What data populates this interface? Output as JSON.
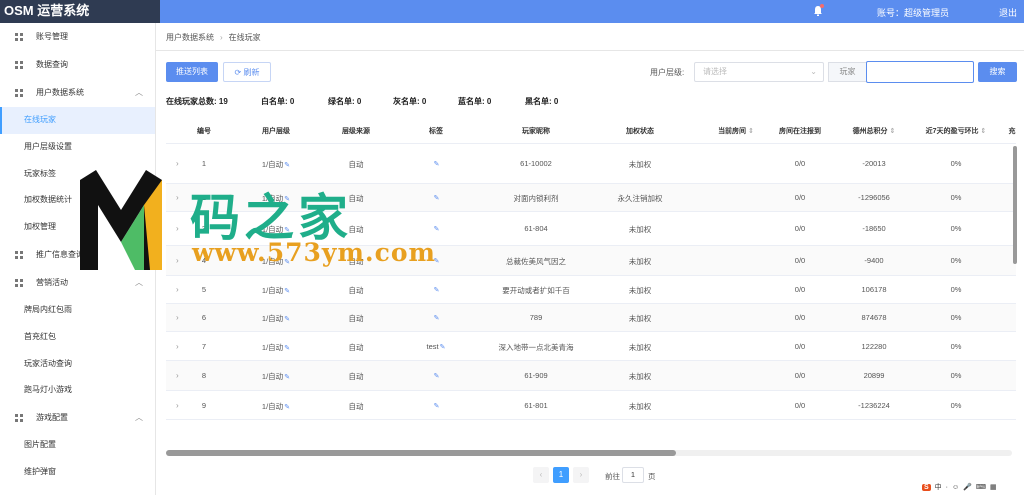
{
  "app": {
    "title": "OSM 运营系统"
  },
  "header": {
    "account_label": "账号：超级管理员",
    "logout_label": "退出"
  },
  "sidebar": {
    "groups": [
      {
        "label": "账号管理",
        "expandable": false
      },
      {
        "label": "数据查询",
        "expandable": false
      },
      {
        "label": "用户数据系统",
        "expandable": true,
        "children": [
          "在线玩家",
          "用户层级设置",
          "玩家标签",
          "加权数据统计",
          "加权管理"
        ]
      },
      {
        "label": "推广信息查询",
        "expandable": false
      },
      {
        "label": "营销活动",
        "expandable": true,
        "children": [
          "牌局内红包雨",
          "首充红包",
          "玩家活动查询",
          "跑马灯小游戏"
        ]
      },
      {
        "label": "游戏配置",
        "expandable": true,
        "children": [
          "图片配置",
          "维护弹窗"
        ]
      }
    ],
    "active_item": "在线玩家"
  },
  "breadcrumb": [
    "用户数据系统",
    "在线玩家"
  ],
  "toolbar": {
    "push_list_label": "推送列表",
    "refresh_label": "刷新",
    "user_level_label": "用户层级:",
    "select_placeholder": "请选择",
    "search_prefix": "玩家",
    "search_value": "",
    "search_button_label": "搜索"
  },
  "stats": {
    "online_total": "在线玩家总数: 19",
    "whitelist": "白名单: 0",
    "greenlist": "绿名单: 0",
    "graylist": "灰名单: 0",
    "bluelist": "蓝名单: 0",
    "blacklist": "黑名单: 0"
  },
  "table": {
    "headers": [
      "编号",
      "用户层级",
      "层级来源",
      "标签",
      "玩家昵称",
      "加权状态",
      "当前房间",
      "房间在注报到",
      "德州总积分",
      "近7天的盈亏环比",
      "充"
    ],
    "sortable": [
      false,
      false,
      false,
      false,
      false,
      false,
      true,
      false,
      true,
      true,
      false
    ],
    "rows": [
      {
        "id": "1",
        "level": "1/自动",
        "source": "自动",
        "tag": "",
        "nickname": "61-10002",
        "status": "未加权",
        "room": "",
        "report": "0/0",
        "score": "-20013",
        "ratio": "0%"
      },
      {
        "id": "2",
        "level": "1/自动",
        "source": "自动",
        "tag": "",
        "nickname": "对面内锁利剂",
        "status": "永久注销加权",
        "room": "",
        "report": "0/0",
        "score": "-1296056",
        "ratio": "0%"
      },
      {
        "id": "3",
        "level": "1/自动",
        "source": "自动",
        "tag": "",
        "nickname": "61-804",
        "status": "未加权",
        "room": "",
        "report": "0/0",
        "score": "-18650",
        "ratio": "0%"
      },
      {
        "id": "4",
        "level": "1/自动",
        "source": "自动",
        "tag": "",
        "nickname": "总裁佐美风气因之",
        "status": "未加权",
        "room": "",
        "report": "0/0",
        "score": "-9400",
        "ratio": "0%"
      },
      {
        "id": "5",
        "level": "1/自动",
        "source": "自动",
        "tag": "",
        "nickname": "要开动或者扩如千百",
        "status": "未加权",
        "room": "",
        "report": "0/0",
        "score": "106178",
        "ratio": "0%"
      },
      {
        "id": "6",
        "level": "1/自动",
        "source": "自动",
        "tag": "",
        "nickname": "789",
        "status": "未加权",
        "room": "",
        "report": "0/0",
        "score": "874678",
        "ratio": "0%"
      },
      {
        "id": "7",
        "level": "1/自动",
        "source": "自动",
        "tag": "test",
        "nickname": "深入地带一点北美青海",
        "status": "未加权",
        "room": "",
        "report": "0/0",
        "score": "122280",
        "ratio": "0%"
      },
      {
        "id": "8",
        "level": "1/自动",
        "source": "自动",
        "tag": "",
        "nickname": "61-909",
        "status": "未加权",
        "room": "",
        "report": "0/0",
        "score": "20899",
        "ratio": "0%"
      },
      {
        "id": "9",
        "level": "1/自动",
        "source": "自动",
        "tag": "",
        "nickname": "61-801",
        "status": "未加权",
        "room": "",
        "report": "0/0",
        "score": "-1236224",
        "ratio": "0%"
      }
    ]
  },
  "pagination": {
    "current_page": "1",
    "goto_prefix": "前往",
    "goto_value": "1",
    "goto_suffix": "页"
  },
  "watermark": {
    "title": "码之家",
    "url": "www.573ym.com",
    "logo_letter": "M"
  },
  "ime": {
    "items": [
      "S",
      "中",
      "·",
      "☺",
      "🎤",
      "⌨",
      "▦",
      "👕",
      "⋯"
    ]
  },
  "colors": {
    "header": "#5b8def",
    "logo_bg": "#2f3b52",
    "accent": "#409eff",
    "watermark_green": "#1fae8a",
    "watermark_orange": "#e8a020"
  },
  "icons": {
    "bell": "bell-icon",
    "menu": "grid-icon",
    "refresh": "refresh-icon",
    "edit": "edit-icon",
    "expand": "chevron-right-icon"
  }
}
